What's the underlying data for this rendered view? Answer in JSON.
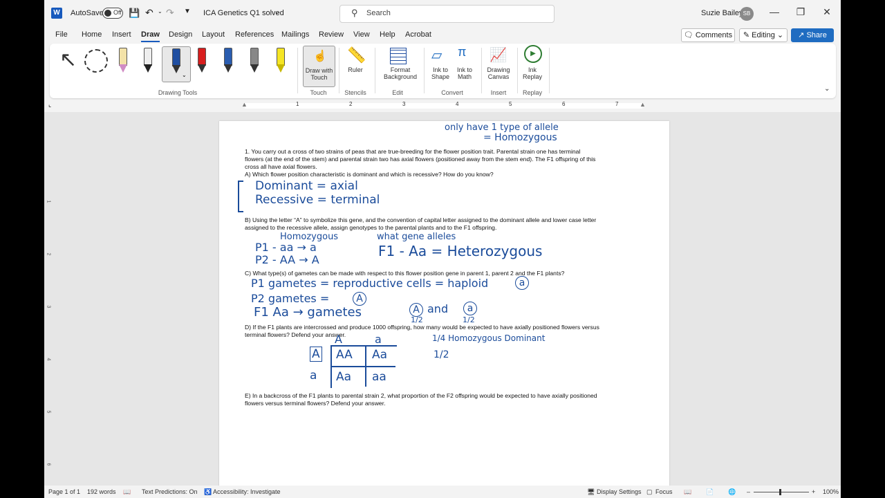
{
  "titlebar": {
    "app_logo": "W",
    "autosave_label": "AutoSave",
    "autosave_state": "Off",
    "doc_title": "ICA Genetics Q1 solved",
    "search_placeholder": "Search",
    "user_name": "Suzie Bailey",
    "user_initials": "SB"
  },
  "menu": {
    "items": [
      "File",
      "Home",
      "Insert",
      "Draw",
      "Design",
      "Layout",
      "References",
      "Mailings",
      "Review",
      "View",
      "Help",
      "Acrobat"
    ],
    "active": "Draw",
    "comments_label": "Comments",
    "editing_label": "Editing",
    "share_label": "Share"
  },
  "ribbon": {
    "drawing_tools_group": "Drawing Tools",
    "touch": {
      "button": "Draw with Touch",
      "group": "Touch"
    },
    "stencils": {
      "button": "Ruler",
      "group": "Stencils"
    },
    "edit": {
      "button": "Format Background",
      "group": "Edit"
    },
    "convert": {
      "ink_to_shape": "Ink to Shape",
      "ink_to_math": "Ink to Math",
      "group": "Convert"
    },
    "insert": {
      "button": "Drawing Canvas",
      "group": "Insert"
    },
    "replay": {
      "button": "Ink Replay",
      "group": "Replay"
    },
    "pen_colors": [
      "#f4b6d8",
      "#333333",
      "#1f4ea1",
      "#d81e1e",
      "#1f4ea1",
      "#444444",
      "#f5e524"
    ]
  },
  "ruler": {
    "numbers": [
      "1",
      "2",
      "3",
      "4",
      "5",
      "6",
      "7"
    ]
  },
  "vruler": {
    "numbers": [
      "1",
      "2",
      "3",
      "4",
      "5",
      "6"
    ]
  },
  "document": {
    "q1_line1": "1.  You carry out a cross of two strains of peas that are true-breeding for the flower position trait.  Parental strain one has terminal",
    "q1_line2": "flowers (at the end of the stem) and parental strain two has axial flowers (positioned away from the stem end).  The F1 offspring of this",
    "q1_line3": "cross all have axial flowers.",
    "qA": "A)  Which flower position characteristic is dominant and which is recessive?  How do you know?",
    "qB_line1": "B)  Using the letter “A” to symbolize this gene, and the convention of capital letter assigned to the dominant allele and lower case letter",
    "qB_line2": "assigned to the recessive allele, assign genotypes to the parental plants and to the F1 offspring.",
    "qC": "C)  What type(s) of gametes can be made with respect to this flower position gene in parent 1, parent 2 and the F1 plants?",
    "qD_line1": "D)  If the F1 plants are intercrossed and produce 1000 offspring, how many would be expected to have axially positioned flowers versus",
    "qD_line2": "terminal flowers?  Defend your answer.",
    "qE_line1": "E) In a backcross of the F1 plants to parental strain 2, what proportion of the F2 offspring would be expected to have axially positioned",
    "qE_line2": "flowers versus terminal flowers? Defend your answer."
  },
  "ink": {
    "note_top1": "only have 1 type of allele",
    "note_top2": "= Homozygous",
    "dominant": "Dominant = axial",
    "recessive": "Recessive = terminal",
    "homozygous": "Homozygous",
    "what_gene": "what gene alleles",
    "p1": "P1 - aa → a",
    "p2": "P2 - AA → A",
    "f1": "F1 - Aa = Heterozygous",
    "p1_gametes": "P1 gametes = reproductive cells = haploid",
    "p1_gamete_symbol": "a",
    "p2_gametes": "P2 gametes =",
    "p2_gamete_symbol": "A",
    "f1_gametes": "F1  Aa → gametes",
    "f1_and": "and",
    "f1_symbol_A": "A",
    "f1_symbol_a": "a",
    "half1": "1/2",
    "half2": "1/2",
    "punnett_head_A": "A",
    "punnett_head_a": "a",
    "punnett_row_A": "A",
    "punnett_row_a": "a",
    "punnett_cells": [
      "AA",
      "Aa",
      "Aa",
      "aa"
    ],
    "quarter_note": "1/4 Homozygous Dominant",
    "half_note": "1/2"
  },
  "status": {
    "page": "Page 1 of 1",
    "words": "192 words",
    "predictions": "Text Predictions: On",
    "accessibility": "Accessibility: Investigate",
    "display_settings": "Display Settings",
    "focus": "Focus",
    "zoom": "100%"
  }
}
